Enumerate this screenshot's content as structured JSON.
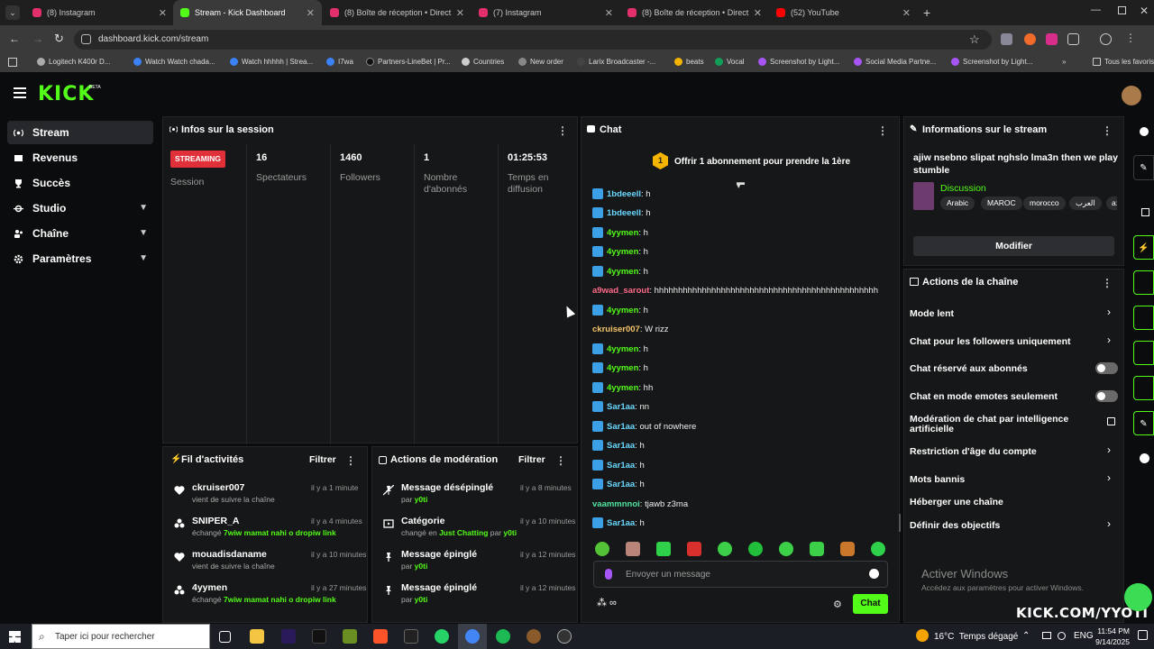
{
  "browser": {
    "tabs": [
      {
        "label": "(8) Instagram",
        "color": "#e1306c"
      },
      {
        "label": "Stream - Kick Dashboard",
        "color": "#53fc18"
      },
      {
        "label": "(8) Boîte de réception • Direct",
        "color": "#e1306c"
      },
      {
        "label": "(7) Instagram",
        "color": "#e1306c"
      },
      {
        "label": "(8) Boîte de réception • Direct",
        "color": "#e1306c"
      },
      {
        "label": "(52) YouTube",
        "color": "#ff0000"
      }
    ],
    "url": "dashboard.kick.com/stream",
    "bookmarks": [
      "Logitech K400r D...",
      "Watch Watch chada...",
      "Watch hhhhh | Strea...",
      "I7wa",
      "Partners-LineBet | Pr...",
      "Countries",
      "New order",
      "Larix Broadcaster -...",
      "beats",
      "Vocal",
      "Screenshot by Light...",
      "Social Media Partne...",
      "Screenshot by Light..."
    ],
    "bookmarks_folder": "Tous les favoris"
  },
  "kick": {
    "logo": "KICK",
    "beta": "BETA"
  },
  "sidebar": {
    "items": [
      {
        "label": "Stream",
        "icon": "broadcast-icon"
      },
      {
        "label": "Revenus",
        "icon": "wallet-icon"
      },
      {
        "label": "Succès",
        "icon": "trophy-icon"
      },
      {
        "label": "Studio",
        "icon": "studio-icon"
      },
      {
        "label": "Chaîne",
        "icon": "users-icon"
      },
      {
        "label": "Paramètres",
        "icon": "gear-icon"
      }
    ]
  },
  "session": {
    "title": "Infos sur la session",
    "badge": "STREAMING",
    "badge_label": "Session",
    "stats": [
      {
        "value": "16",
        "label": "Spectateurs"
      },
      {
        "value": "1460",
        "label": "Followers"
      },
      {
        "value": "1",
        "label": "Nombre d'abonnés"
      },
      {
        "value": "01:25:53",
        "label": "Temps en diffusion"
      }
    ]
  },
  "activity": {
    "title": "Fil d'activités",
    "filter": "Filtrer",
    "items": [
      {
        "name": "ckruiser007",
        "sub": "vient de suivre la chaîne",
        "time": "il y a 1 minute"
      },
      {
        "name": "SNIPER_A",
        "sub_pre": "échangé ",
        "sub_hl": "7wiw mamat nahi o dropiw link",
        "time": "il y a 4 minutes"
      },
      {
        "name": "mouadisdaname",
        "sub": "vient de suivre la chaîne",
        "time": "il y a 10 minutes"
      },
      {
        "name": "4yymen",
        "sub_pre": "échangé ",
        "sub_hl": "7wiw mamat nahi o dropiw link",
        "time": "il y a 27 minutes"
      }
    ]
  },
  "moderation": {
    "title": "Actions de modération",
    "filter": "Filtrer",
    "items": [
      {
        "name": "Message désépinglé",
        "by": "par ",
        "user": "y0ti",
        "time": "il y a 8 minutes"
      },
      {
        "name": "Catégorie",
        "by": "changé en ",
        "cat": "Just Chatting",
        "by2": " par ",
        "user": "y0ti",
        "time": "il y a 10 minutes"
      },
      {
        "name": "Message épinglé",
        "by": "par ",
        "user": "y0ti",
        "time": "il y a 12 minutes"
      },
      {
        "name": "Message épinglé",
        "by": "par ",
        "user": "y0ti",
        "time": "il y a 12 minutes"
      }
    ]
  },
  "chat": {
    "title": "Chat",
    "gift_count": "1",
    "gift_text": "Offrir 1 abonnement pour prendre la 1ère",
    "messages": [
      {
        "user": "1bdeeell",
        "text": ": h",
        "color": "#6ad7ff",
        "badge": true
      },
      {
        "user": "1bdeeell",
        "text": ": h",
        "color": "#6ad7ff",
        "badge": true
      },
      {
        "user": "4yymen",
        "text": ": h",
        "color": "#53fc18",
        "badge": true
      },
      {
        "user": "4yymen",
        "text": ": h",
        "color": "#53fc18",
        "badge": true
      },
      {
        "user": "4yymen",
        "text": ": h",
        "color": "#53fc18",
        "badge": true
      },
      {
        "user": "a9wad_sarout",
        "text": ": hhhhhhhhhhhhhhhhhhhhhhhhhhhhhhhhhhhhhhhhhhhhhhh",
        "color": "#ff6a8a",
        "badge": false
      },
      {
        "user": "4yymen",
        "text": ": h",
        "color": "#53fc18",
        "badge": true
      },
      {
        "user": "ckruiser007",
        "text": ": W rizz",
        "color": "#f4c66a",
        "badge": false
      },
      {
        "user": "4yymen",
        "text": ": h",
        "color": "#53fc18",
        "badge": true
      },
      {
        "user": "4yymen",
        "text": ": h",
        "color": "#53fc18",
        "badge": true
      },
      {
        "user": "4yymen",
        "text": ": hh",
        "color": "#53fc18",
        "badge": true
      },
      {
        "user": "Sar1aa",
        "text": ": nn",
        "color": "#6ad7ff",
        "badge": true
      },
      {
        "user": "Sar1aa",
        "text": ": out of nowhere",
        "color": "#6ad7ff",
        "badge": true
      },
      {
        "user": "Sar1aa",
        "text": ": h",
        "color": "#6ad7ff",
        "badge": true
      },
      {
        "user": "Sar1aa",
        "text": ": h",
        "color": "#6ad7ff",
        "badge": true
      },
      {
        "user": "Sar1aa",
        "text": ": h",
        "color": "#6ad7ff",
        "badge": true
      },
      {
        "user": "vaammnnoi",
        "text": ": tjawb z3ma",
        "color": "#4fe3a0",
        "badge": false
      },
      {
        "user": "Sar1aa",
        "text": ": h",
        "color": "#6ad7ff",
        "badge": true
      }
    ],
    "placeholder": "Envoyer un message",
    "send": "Chat"
  },
  "stream_info": {
    "title": "Informations sur le stream",
    "stream_title": "ajiw nsebno slipat nghslo lma3n then we play stumble",
    "category": "Discussion",
    "tags": [
      "Arabic",
      "MAROC",
      "morocco",
      "العرب",
      "a:"
    ],
    "edit": "Modifier"
  },
  "channel_actions": {
    "title": "Actions de la chaîne",
    "items": [
      {
        "label": "Mode lent",
        "control": "arrow"
      },
      {
        "label": "Chat pour les followers uniquement",
        "control": "arrow"
      },
      {
        "label": "Chat réservé aux abonnés",
        "control": "toggle"
      },
      {
        "label": "Chat en mode emotes seulement",
        "control": "toggle"
      },
      {
        "label": "Modération de chat par intelligence artificielle",
        "control": "external"
      },
      {
        "label": "Restriction d'âge du compte",
        "control": "arrow"
      },
      {
        "label": "Mots bannis",
        "control": "arrow"
      },
      {
        "label": "Héberger une chaîne",
        "control": "none"
      },
      {
        "label": "Définir des objectifs",
        "control": "arrow"
      }
    ]
  },
  "watermark": {
    "line1": "Activer Windows",
    "line2": "Accédez aux paramètres pour activer Windows."
  },
  "overlay": {
    "kick_url": "KICK.COM/YYOTI"
  },
  "taskbar": {
    "search": "Taper ici pour rechercher",
    "weather": "16°C  Temps dégagé",
    "lang": "ENG",
    "time": "11:54 PM",
    "date": "9/14/2025"
  }
}
